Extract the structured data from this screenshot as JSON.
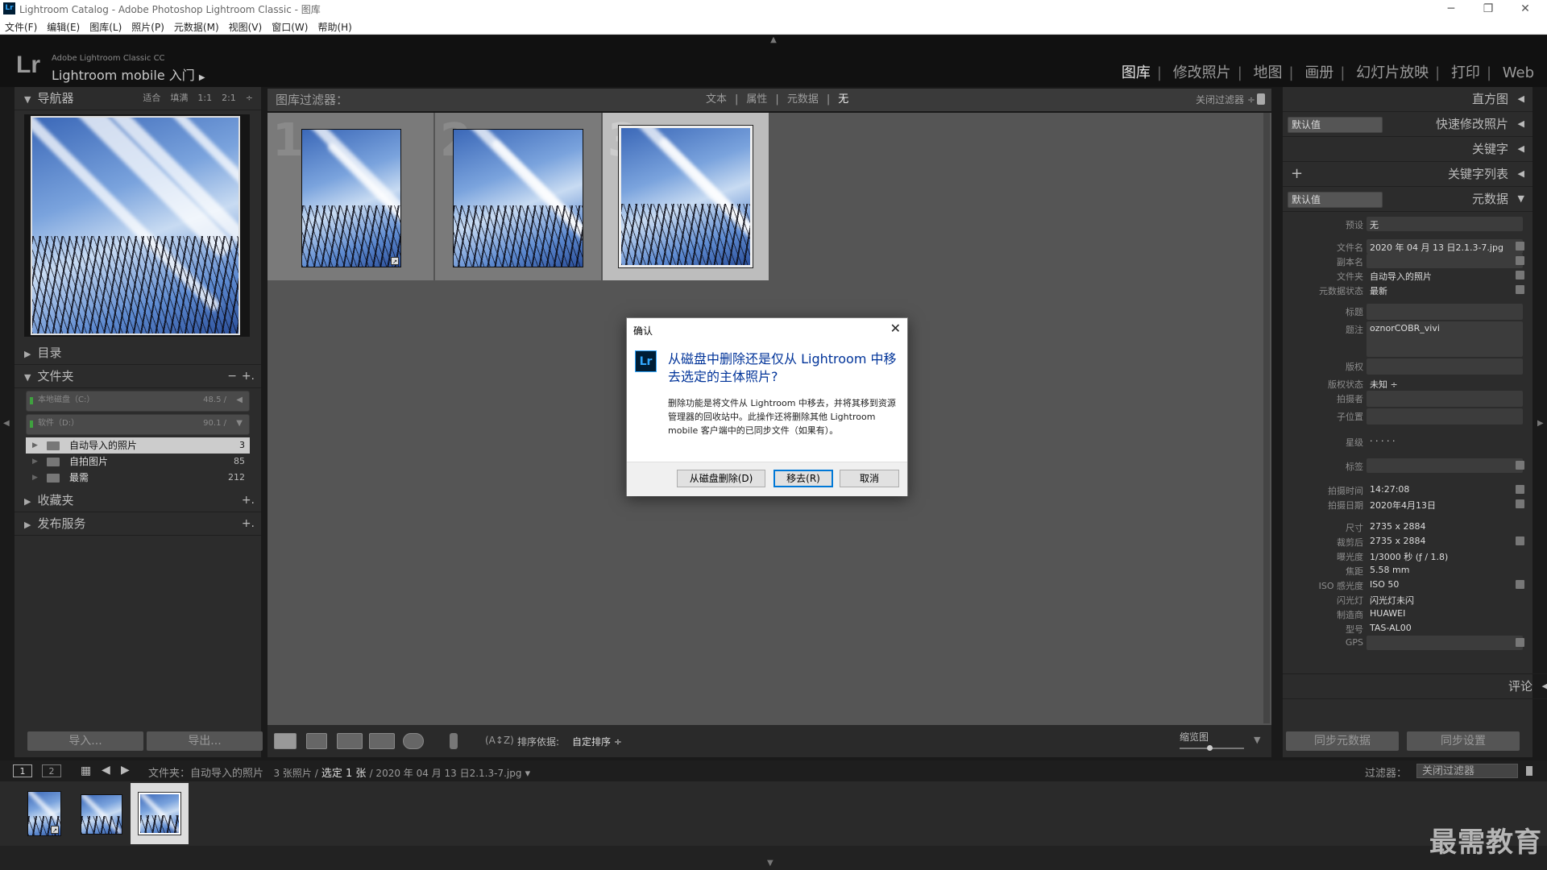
{
  "window": {
    "title": "Lightroom Catalog - Adobe Photoshop Lightroom Classic - 图库",
    "app_icon": "Lr",
    "controls": [
      "─",
      "❐",
      "✕"
    ]
  },
  "menu": [
    "文件(F)",
    "编辑(E)",
    "图库(L)",
    "照片(P)",
    "元数据(M)",
    "视图(V)",
    "窗口(W)",
    "帮助(H)"
  ],
  "identity": {
    "logo": "Lr",
    "line1": "Adobe Lightroom Classic CC",
    "line2": "Lightroom mobile 入门",
    "arrow": "▶"
  },
  "modules": {
    "items": [
      "图库",
      "修改照片",
      "地图",
      "画册",
      "幻灯片放映",
      "打印",
      "Web"
    ],
    "active": "图库",
    "separator": "|"
  },
  "left_panel": {
    "navigator": {
      "title": "导航器",
      "options": [
        "适合",
        "填满",
        "1:1",
        "2:1"
      ]
    },
    "catalog": {
      "title": "目录"
    },
    "folders": {
      "title": "文件夹",
      "volumes": [
        {
          "name": "本地磁盘（C:）",
          "value": "48.5 / ",
          "arrow": "◀"
        },
        {
          "name": "软件（D:）",
          "value": "90.1 / ",
          "arrow": "▼"
        }
      ],
      "items": [
        {
          "name": "自动导入的照片",
          "count": "3",
          "selected": true
        },
        {
          "name": "自拍图片",
          "count": "85",
          "selected": false
        },
        {
          "name": "最需",
          "count": "212",
          "selected": false
        }
      ]
    },
    "collections": {
      "title": "收藏夹"
    },
    "publish": {
      "title": "发布服务"
    },
    "buttons": {
      "import": "导入...",
      "export": "导出..."
    }
  },
  "filter_bar": {
    "title": "图库过滤器：",
    "options": [
      "文本",
      "属性",
      "元数据",
      "无"
    ],
    "active": "无",
    "close": "关闭过滤器 ÷"
  },
  "grid": {
    "cells": [
      {
        "index": "1",
        "selected": false,
        "has_badge": true
      },
      {
        "index": "2",
        "selected": false,
        "has_badge": false
      },
      {
        "index": "3",
        "selected": true,
        "has_badge": false
      }
    ]
  },
  "toolbar": {
    "sort_label": "排序依据:",
    "sort_value": "自定排序 ÷",
    "thumb_label": "缩览图"
  },
  "right_panel": {
    "histogram": "直方图",
    "quick_develop": {
      "title": "快速修改照片",
      "preset": "默认值"
    },
    "keywords": "关键字",
    "keyword_list": "关键字列表",
    "metadata": {
      "title": "元数据",
      "preset_select": "默认值",
      "preset_label": "预设",
      "preset_value": "无",
      "rows": [
        {
          "label": "文件名",
          "value": "2020 年 04 月 13 日2.1.3-7.jpg"
        },
        {
          "label": "副本名",
          "value": ""
        },
        {
          "label": "文件夹",
          "value": "自动导入的照片"
        },
        {
          "label": "元数据状态",
          "value": "最新"
        },
        {
          "label": "标题",
          "value": ""
        },
        {
          "label": "题注",
          "value": "oznorCOBR_vivi"
        },
        {
          "label": "版权",
          "value": ""
        },
        {
          "label": "版权状态",
          "value": "未知 ÷"
        },
        {
          "label": "拍摄者",
          "value": ""
        },
        {
          "label": "子位置",
          "value": ""
        },
        {
          "label": "星级",
          "value": "· · · · ·"
        },
        {
          "label": "标签",
          "value": ""
        },
        {
          "label": "拍摄时间",
          "value": "14:27:08"
        },
        {
          "label": "拍摄日期",
          "value": "2020年4月13日"
        },
        {
          "label": "尺寸",
          "value": "2735 x 2884"
        },
        {
          "label": "裁剪后",
          "value": "2735 x 2884"
        },
        {
          "label": "曝光度",
          "value": "1/3000 秒 (ƒ / 1.8)"
        },
        {
          "label": "焦距",
          "value": "5.58 mm"
        },
        {
          "label": "ISO 感光度",
          "value": "ISO 50"
        },
        {
          "label": "闪光灯",
          "value": "闪光灯未闪"
        },
        {
          "label": "制造商",
          "value": "HUAWEI"
        },
        {
          "label": "型号",
          "value": "TAS-AL00"
        },
        {
          "label": "GPS",
          "value": ""
        }
      ]
    },
    "comments": "评论",
    "buttons": {
      "sync_meta": "同步元数据",
      "sync_settings": "同步设置"
    }
  },
  "filmstrip_bar": {
    "screen1": "1",
    "screen2": "2",
    "path_prefix": "文件夹：",
    "folder": "自动导入的照片",
    "count": "3 张照片 /",
    "selected": "选定 1 张",
    "filename": "/ 2020 年 04 月 13 日2.1.3-7.jpg",
    "filter_label": "过滤器：",
    "filter_value": "关闭过滤器"
  },
  "watermark": "最需教育",
  "dialog": {
    "title": "确认",
    "icon": "Lr",
    "heading": "从磁盘中删除还是仅从 Lightroom 中移去选定的主体照片?",
    "body": "删除功能是将文件从 Lightroom 中移去，并将其移到资源管理器的回收站中。此操作还将删除其他 Lightroom mobile 客户端中的已同步文件（如果有）。",
    "buttons": {
      "delete": "从磁盘删除(D)",
      "remove": "移去(R)",
      "cancel": "取消"
    }
  }
}
